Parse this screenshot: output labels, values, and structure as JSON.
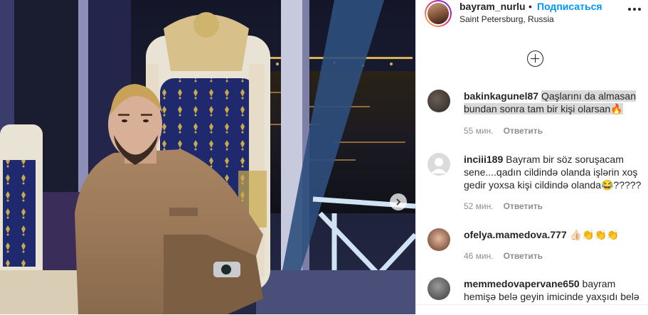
{
  "post": {
    "username": "bayram_nurlu",
    "separator": "•",
    "follow_label": "Подписаться",
    "location": "Saint Petersburg, Russia"
  },
  "icons": {
    "more": "more-options-icon",
    "load_more": "plus-circle-icon",
    "next": "chevron-right-icon"
  },
  "colors": {
    "link_blue": "#0095f6",
    "meta_gray": "#8e8e8e",
    "highlight": "#d9d9d9"
  },
  "comments": [
    {
      "user": "bakinkagunel87",
      "text": "Qaşlarını da almasan bundan sonra tam bir kişi olarsan🔥",
      "time": "55 мин.",
      "reply": "Ответить",
      "highlighted": true
    },
    {
      "user": "inciii189",
      "text": "Bayram bir söz soruşacam sene....qadın cildində olanda işlərin xoş gedir yoxsa kişi cildində olanda😂?????",
      "time": "52 мин.",
      "reply": "Ответить"
    },
    {
      "user": "ofelya.mamedova.777",
      "text": "👍🏻👏👏👏",
      "time": "46 мин.",
      "reply": "Ответить"
    },
    {
      "user": "memmedovapervane650",
      "text": "bayram hemişə belə geyin imicinde yaxşıdı belə",
      "time": "",
      "reply": ""
    }
  ]
}
